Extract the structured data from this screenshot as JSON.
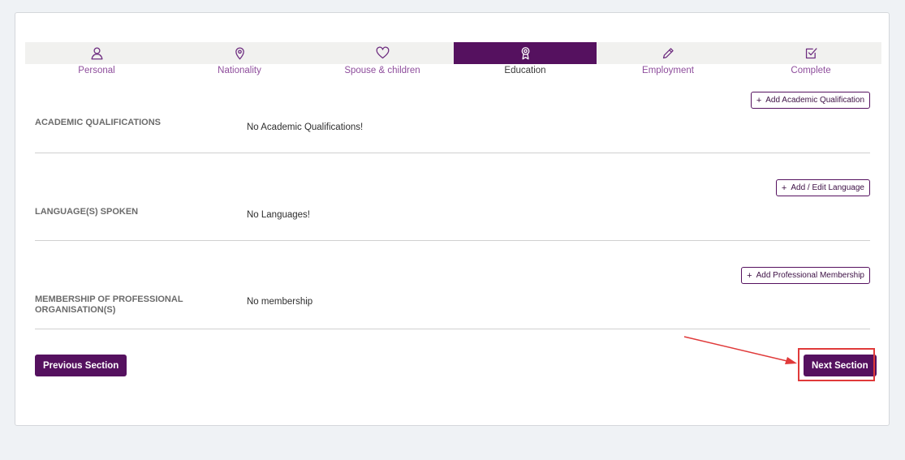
{
  "steps": [
    {
      "label": "Personal",
      "icon": "user-icon",
      "active": false
    },
    {
      "label": "Nationality",
      "icon": "location-pin-icon",
      "active": false
    },
    {
      "label": "Spouse & children",
      "icon": "heart-icon",
      "active": false
    },
    {
      "label": "Education",
      "icon": "award-ribbon-icon",
      "active": true
    },
    {
      "label": "Employment",
      "icon": "pencil-icon",
      "active": false
    },
    {
      "label": "Complete",
      "icon": "checkbox-icon",
      "active": false
    }
  ],
  "sections": {
    "academic": {
      "title": "ACADEMIC QUALIFICATIONS",
      "value": "No Academic Qualifications!",
      "button": "Add Academic Qualification"
    },
    "languages": {
      "title": "LANGUAGE(S) SPOKEN",
      "value": "No Languages!",
      "button": "Add / Edit Language"
    },
    "membership": {
      "title": "MEMBERSHIP OF PROFESSIONAL ORGANISATION(S)",
      "value": "No membership",
      "button": "Add Professional Membership"
    }
  },
  "plus_symbol": "+",
  "nav": {
    "previous": "Previous Section",
    "next": "Next Section"
  },
  "colors": {
    "brand": "#55115f",
    "highlight": "#e03a3a"
  }
}
